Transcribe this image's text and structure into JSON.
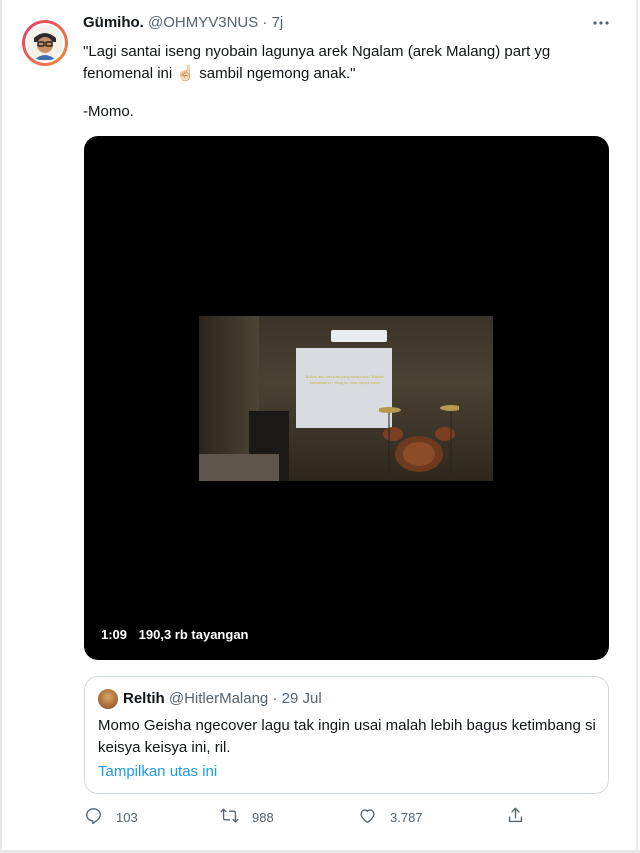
{
  "tweet": {
    "display_name": "Gümiho.",
    "handle": "@OHMYV3NUS",
    "separator": "·",
    "time": "7j",
    "text": "\"Lagi santai iseng nyobain lagunya arek Ngalam (arek Malang) part yg fenomenal ini ☝🏻 sambil ngemong anak.\"",
    "signature": "-Momo.",
    "more_icon": "more-horizontal-icon"
  },
  "media": {
    "duration": "1:09",
    "views": "190,3 rb tayangan",
    "screen_lyrics": "Bukan aku mencari yang sempurna / Biarlah bersamamu / Yang ku mau hanya kamu"
  },
  "quoted_tweet": {
    "display_name": "Reltih",
    "handle": "@HitlerMalang",
    "separator": "·",
    "time": "29 Jul",
    "text": "Momo Geisha ngecover lagu tak ingin usai malah lebih bagus ketimbang si keisya keisya ini, ril.",
    "show_thread_link": "Tampilkan utas ini"
  },
  "actions": {
    "reply_count": "103",
    "retweet_count": "988",
    "like_count": "3.787",
    "icons": [
      "reply-icon",
      "retweet-icon",
      "like-icon",
      "share-icon"
    ]
  },
  "colors": {
    "link": "#1d9bf0",
    "secondary_text": "#536471",
    "primary_text": "#0f1419",
    "border": "#cfd9de"
  }
}
